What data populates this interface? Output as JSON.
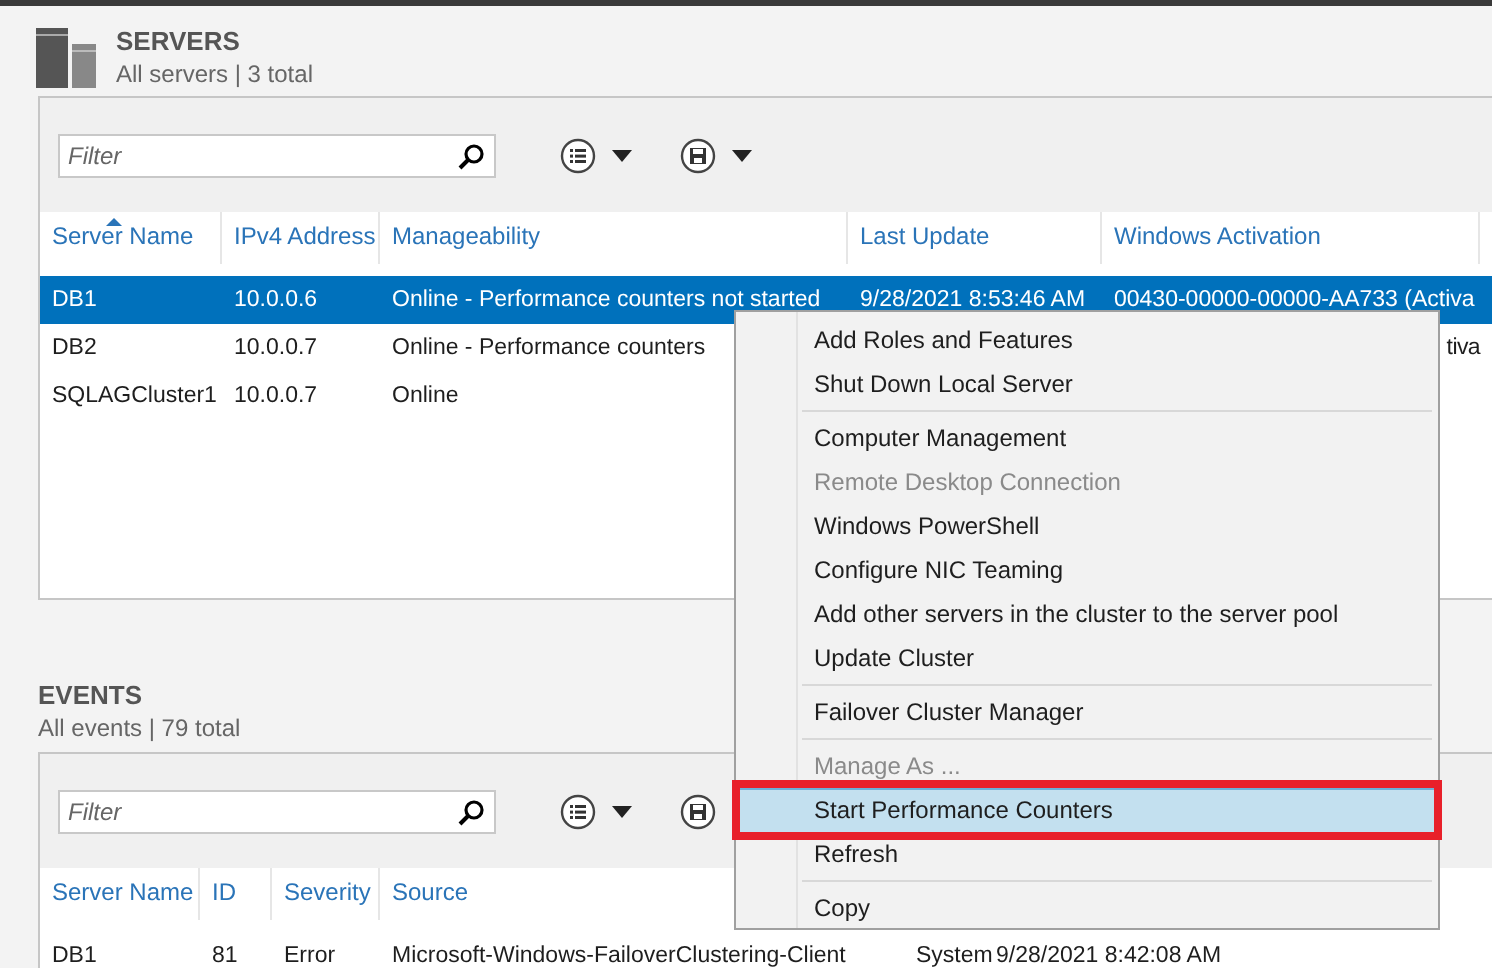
{
  "servers": {
    "title": "SERVERS",
    "subtitle": "All servers | 3 total",
    "filter": {
      "placeholder": "Filter"
    },
    "columns": [
      {
        "label": "Server Name",
        "sorted": true
      },
      {
        "label": "IPv4 Address",
        "sorted": false
      },
      {
        "label": "Manageability",
        "sorted": false
      },
      {
        "label": "Last Update",
        "sorted": false
      },
      {
        "label": "Windows Activation",
        "sorted": false
      }
    ],
    "rows": [
      {
        "selected": true,
        "cells": [
          "DB1",
          "10.0.0.6",
          "Online - Performance counters not started",
          "9/28/2021 8:53:46 AM",
          "00430-00000-00000-AA733 (Activa"
        ]
      },
      {
        "selected": false,
        "cells": [
          "DB2",
          "10.0.0.7",
          "Online - Performance counters",
          "",
          "tiva"
        ]
      },
      {
        "selected": false,
        "cells": [
          "SQLAGCluster1",
          "10.0.0.7",
          "Online",
          "",
          ""
        ]
      }
    ]
  },
  "events": {
    "title": "EVENTS",
    "subtitle": "All events | 79 total",
    "filter": {
      "placeholder": "Filter"
    },
    "columns": [
      {
        "label": "Server Name",
        "sorted": false
      },
      {
        "label": "ID",
        "sorted": false
      },
      {
        "label": "Severity",
        "sorted": false
      },
      {
        "label": "Source",
        "sorted": false
      }
    ],
    "rows": [
      {
        "selected": false,
        "cells": [
          "DB1",
          "81",
          "Error",
          "Microsoft-Windows-FailoverClustering-Client",
          "System",
          "9/28/2021 8:42:08 AM"
        ]
      }
    ]
  },
  "context_menu": {
    "groups": [
      [
        {
          "label": "Add Roles and Features",
          "disabled": false,
          "selected": false,
          "outlined": false
        },
        {
          "label": "Shut Down Local Server",
          "disabled": false,
          "selected": false,
          "outlined": false
        }
      ],
      [
        {
          "label": "Computer Management",
          "disabled": false,
          "selected": false,
          "outlined": false
        },
        {
          "label": "Remote Desktop Connection",
          "disabled": true,
          "selected": false,
          "outlined": false
        },
        {
          "label": "Windows PowerShell",
          "disabled": false,
          "selected": false,
          "outlined": false
        },
        {
          "label": "Configure NIC Teaming",
          "disabled": false,
          "selected": false,
          "outlined": false
        },
        {
          "label": "Add other servers in the cluster to the server pool",
          "disabled": false,
          "selected": false,
          "outlined": false
        },
        {
          "label": "Update Cluster",
          "disabled": false,
          "selected": false,
          "outlined": false
        }
      ],
      [
        {
          "label": "Failover Cluster Manager",
          "disabled": false,
          "selected": false,
          "outlined": false
        }
      ],
      [
        {
          "label": "Manage As ...",
          "disabled": true,
          "selected": false,
          "outlined": false
        },
        {
          "label": "Start Performance Counters",
          "disabled": false,
          "selected": true,
          "outlined": true
        },
        {
          "label": "Refresh",
          "disabled": false,
          "selected": false,
          "outlined": false
        }
      ],
      [
        {
          "label": "Copy",
          "disabled": false,
          "selected": false,
          "outlined": false
        }
      ]
    ]
  }
}
